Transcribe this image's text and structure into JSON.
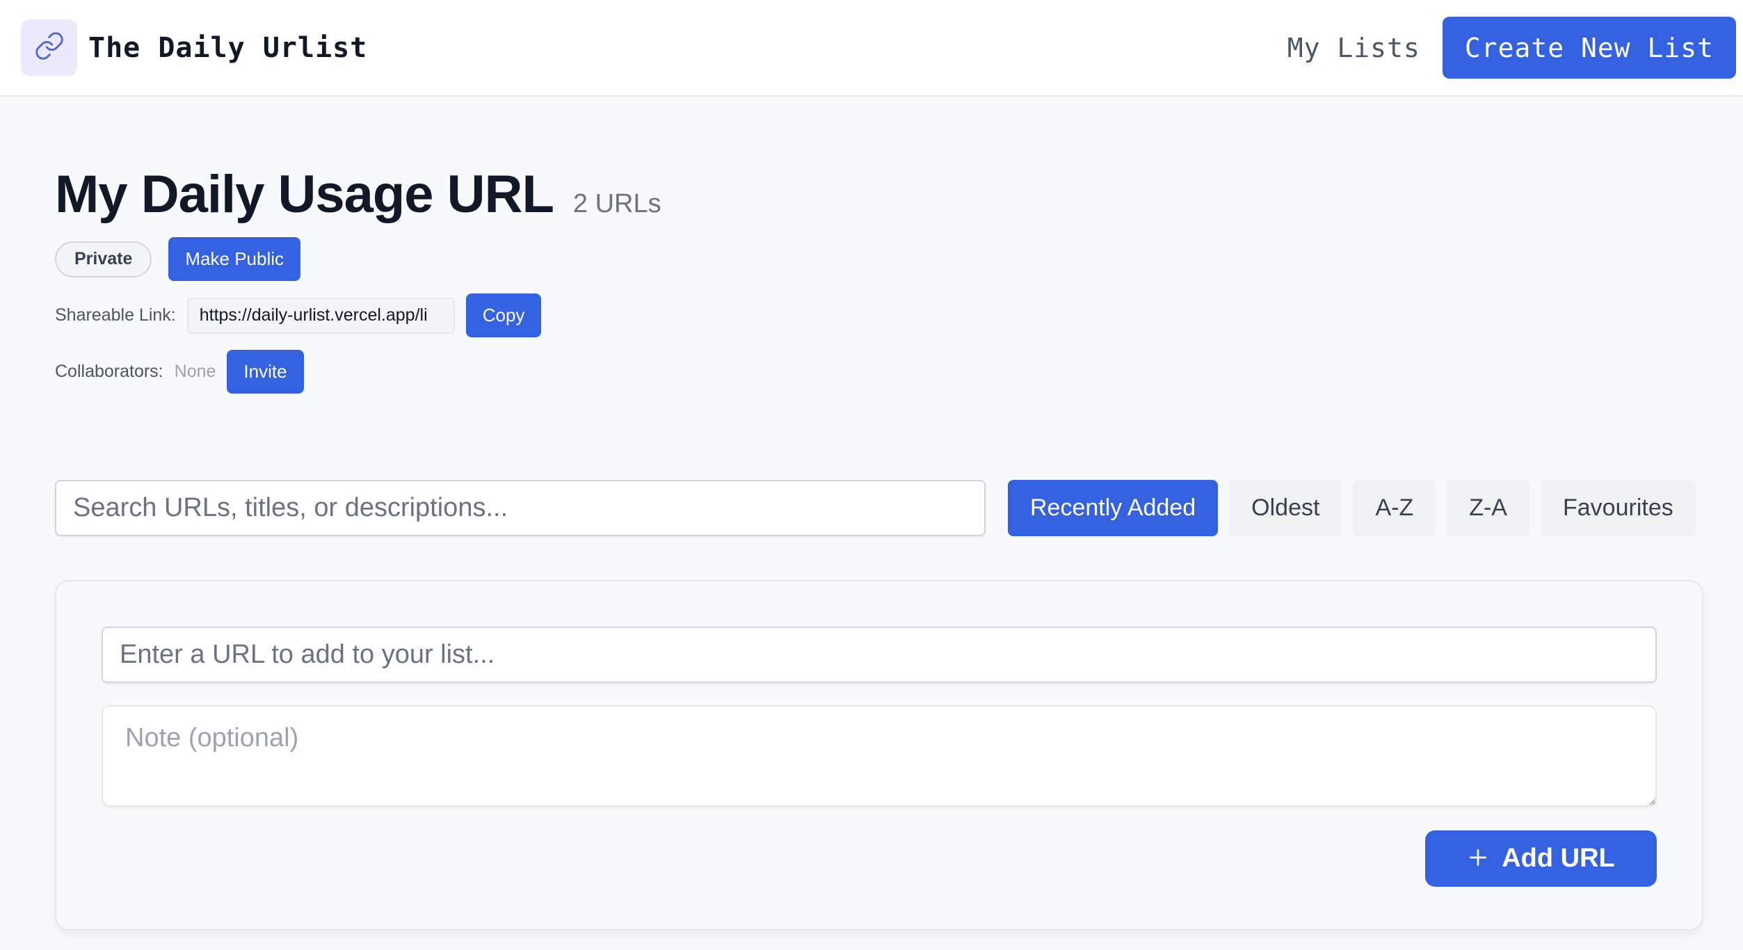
{
  "header": {
    "app_title": "The Daily Urlist",
    "logo_icon": "link-icon",
    "nav_my_lists": "My Lists",
    "nav_create": "Create New List"
  },
  "list": {
    "title": "My Daily Usage URL",
    "url_count": "2 URLs",
    "visibility_badge": "Private",
    "make_public_label": "Make Public",
    "shareable_label": "Shareable Link:",
    "shareable_value": "https://daily-urlist.vercel.app/li",
    "copy_label": "Copy",
    "collaborators_label": "Collaborators:",
    "collaborators_value": "None",
    "invite_label": "Invite"
  },
  "search": {
    "placeholder": "Search URLs, titles, or descriptions..."
  },
  "sort": {
    "options": [
      "Recently Added",
      "Oldest",
      "A-Z",
      "Z-A",
      "Favourites"
    ],
    "active": "Recently Added"
  },
  "add_form": {
    "url_placeholder": "Enter a URL to add to your list...",
    "note_placeholder": "Note (optional)",
    "add_button_label": "Add URL",
    "add_button_icon": "plus-icon"
  },
  "colors": {
    "accent": "#3461e0",
    "background": "#f8f9fa",
    "logo_bg": "#ece9fb"
  }
}
